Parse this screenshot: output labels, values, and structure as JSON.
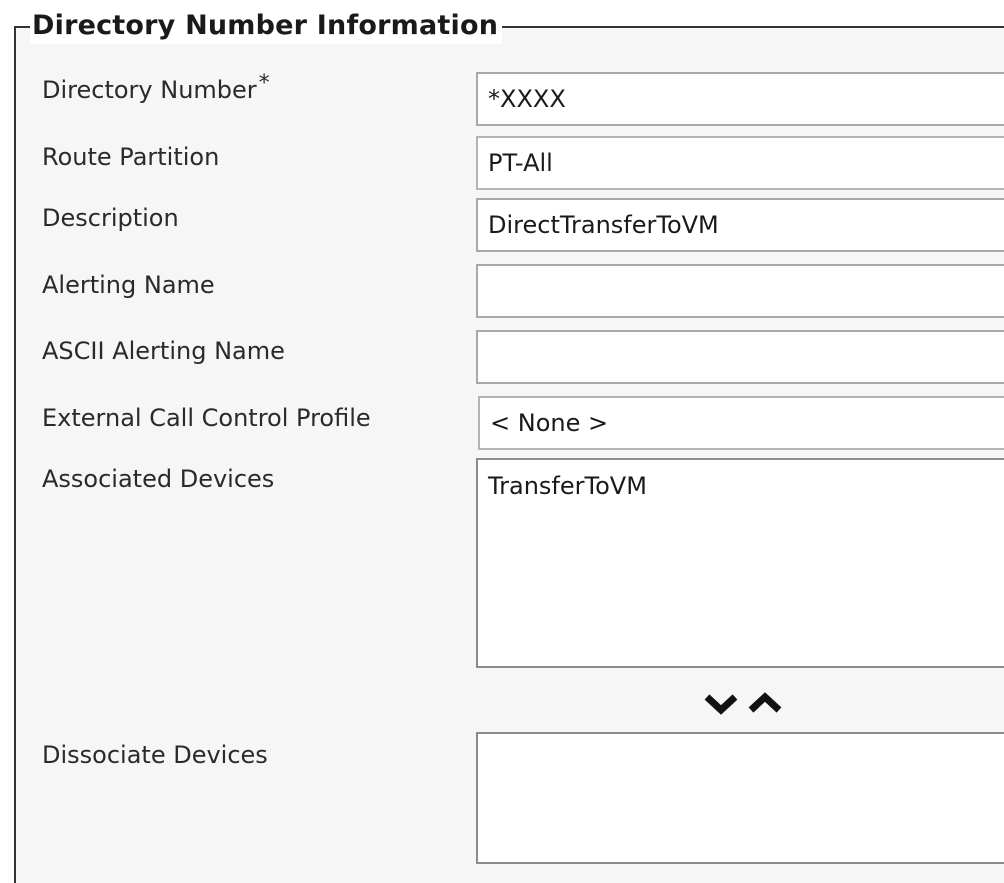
{
  "section": {
    "legend": "Directory Number Information"
  },
  "fields": {
    "directory_number": {
      "label": "Directory Number",
      "required_mark": "*",
      "value": "*XXXX"
    },
    "route_partition": {
      "label": "Route Partition",
      "value": "PT-All"
    },
    "description": {
      "label": "Description",
      "value": "DirectTransferToVM"
    },
    "alerting_name": {
      "label": "Alerting Name",
      "value": ""
    },
    "ascii_alerting_name": {
      "label": "ASCII Alerting Name",
      "value": ""
    },
    "external_call_control_profile": {
      "label": "External Call Control Profile",
      "value": "< None >"
    },
    "associated_devices": {
      "label": "Associated Devices",
      "items": [
        "TransferToVM"
      ]
    },
    "dissociate_devices": {
      "label": "Dissociate Devices",
      "items": []
    }
  },
  "icons": {
    "move_down": "chevron-down-icon",
    "move_up": "chevron-up-icon"
  }
}
